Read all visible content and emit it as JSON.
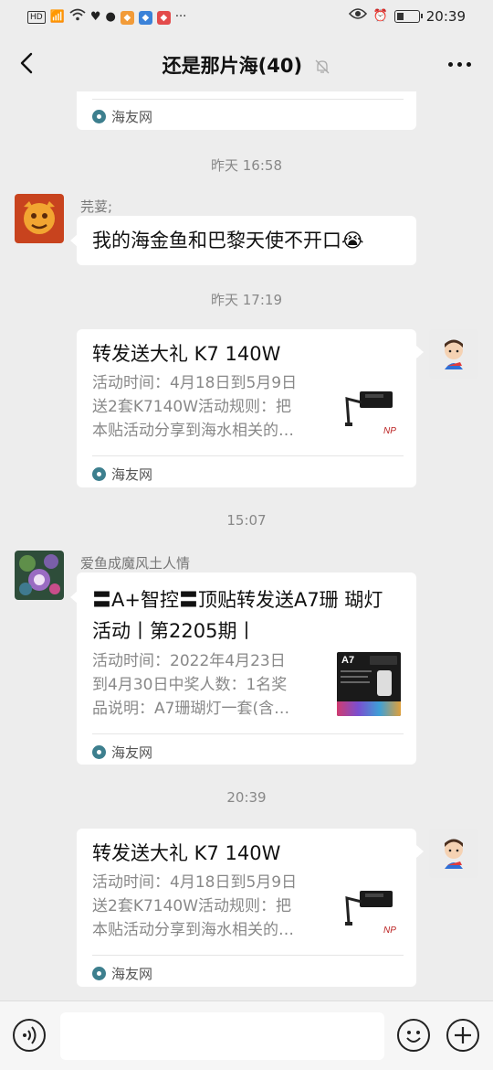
{
  "status_bar": {
    "left_text": "HD 4G",
    "time": "20:39"
  },
  "nav": {
    "title": "还是那片海(40)"
  },
  "messages": {
    "top_partial": {
      "source": "海友网"
    },
    "ts1": "昨天 16:58",
    "msg1": {
      "sender": "芫荽;",
      "text": "我的海金鱼和巴黎天使不开口😭"
    },
    "ts2": "昨天 17:19",
    "card1": {
      "title": "转发送大礼 K7 140W",
      "desc_lines": [
        "活动时间：4月18日到5月9日",
        "送2套K7140W活动规则：把",
        "本贴活动分享到海水相关的…"
      ],
      "source": "海友网"
    },
    "ts3": "15:07",
    "msg2": {
      "sender": "爱鱼成魔风土人情",
      "title_lines": [
        "〓A+智控〓顶贴转发送A7珊 瑚灯",
        "活动丨第2205期丨"
      ],
      "desc_lines": [
        "活动时间：2022年4月23日",
        "到4月30日中奖人数：1名奖",
        "品说明：A7珊瑚灯一套(含…"
      ],
      "thumb_label": "A7",
      "source": "海友网"
    },
    "ts4": "20:39",
    "card2": {
      "title": "转发送大礼 K7 140W",
      "desc_lines": [
        "活动时间：4月18日到5月9日",
        "送2套K7140W活动规则：把",
        "本贴活动分享到海水相关的…"
      ],
      "source": "海友网"
    }
  },
  "colors": {
    "background": "#ededed",
    "card": "#ffffff",
    "muted_text": "#888888",
    "source_icon": "#3d7f8e"
  },
  "icons": [
    "back-arrow-icon",
    "mute-bell-icon",
    "more-icon",
    "voice-icon",
    "emoji-icon",
    "plus-icon"
  ]
}
